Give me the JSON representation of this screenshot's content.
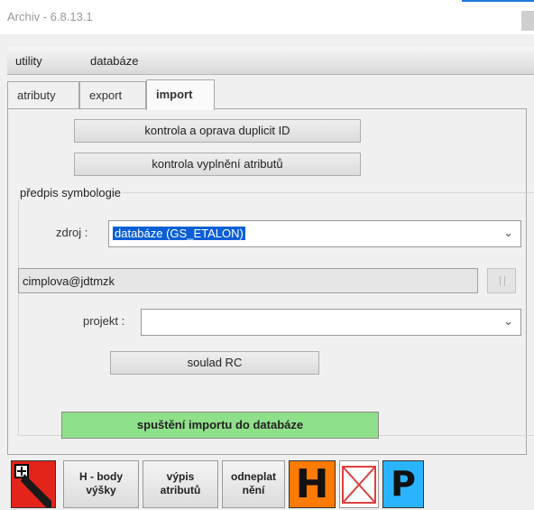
{
  "window": {
    "title": "Archiv - 6.8.13.1"
  },
  "menu": {
    "items": [
      "utility",
      "databáze"
    ]
  },
  "tabs": [
    "atributy",
    "export",
    "import"
  ],
  "import_panel": {
    "btn_duplicates": "kontrola a oprava duplicit ID",
    "btn_attributes": "kontrola vyplnění atributů",
    "symbology": {
      "group_label": "předpis symbologie",
      "source_label": "zdroj :",
      "source_value": "databáze (GS_ETALON)"
    },
    "user_field": "cimplova@jdtmzk",
    "project_label": "projekt :",
    "project_value": "",
    "btn_soulad": "soulad RC",
    "btn_start_import": "spuštění importu do databáze"
  },
  "toolbar": {
    "h_body_line1": "H - body",
    "h_body_line2": "výšky",
    "vypis_line1": "výpis",
    "vypis_line2": "atributů",
    "odneplat_line1": "odneplat",
    "odneplat_line2": "nění",
    "h_icon_letter": "H",
    "p_icon_letter": "P"
  },
  "colors": {
    "selection": "#0a5fd6",
    "start_import_green": "#8fe08a",
    "h_icon_orange": "#ff7a00",
    "p_icon_cyan": "#2ab4ff",
    "x_icon_red": "#e04040",
    "red_icon": "#e3241b"
  }
}
